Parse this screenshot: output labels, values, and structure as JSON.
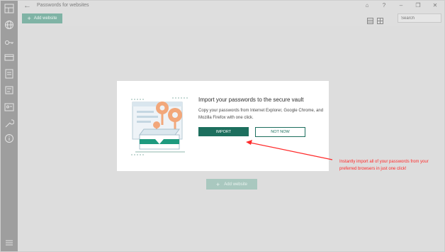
{
  "app": {
    "title": "Passwords for websites",
    "back_glyph": "←"
  },
  "titlebar_icons": [
    {
      "name": "vault-icon",
      "glyph": "⌂"
    },
    {
      "name": "help-icon",
      "glyph": "?"
    },
    {
      "name": "minimize-icon",
      "glyph": "–"
    },
    {
      "name": "restore-icon",
      "glyph": "❐"
    },
    {
      "name": "close-icon",
      "glyph": "✕"
    }
  ],
  "toolbar": {
    "add_label": "Add website",
    "plus_glyph": "+",
    "search_placeholder": "Search"
  },
  "dialog": {
    "title": "Import your passwords to the secure vault",
    "body": "Copy your passwords from Internet Explorer, Google Chrome, and Mozilla Firefox with one click.",
    "import_label": "IMPORT",
    "not_now_label": "NOT NOW"
  },
  "bottom_add": {
    "label": "Add website",
    "plus_glyph": "+"
  },
  "annotation": {
    "text": "Instantly import all of your passwords from your preferred browsers in just one click!",
    "color": "#ff2a2a"
  },
  "colors": {
    "accent": "#1d6f5e",
    "rail": "#9e9e9e",
    "background": "#dddddd"
  },
  "sidebar_icons": [
    "dashboard-icon",
    "globe-icon",
    "key-icon",
    "credit-card-icon",
    "document-icon",
    "notes-icon",
    "id-card-icon",
    "tools-icon",
    "info-icon",
    "menu-icon"
  ]
}
